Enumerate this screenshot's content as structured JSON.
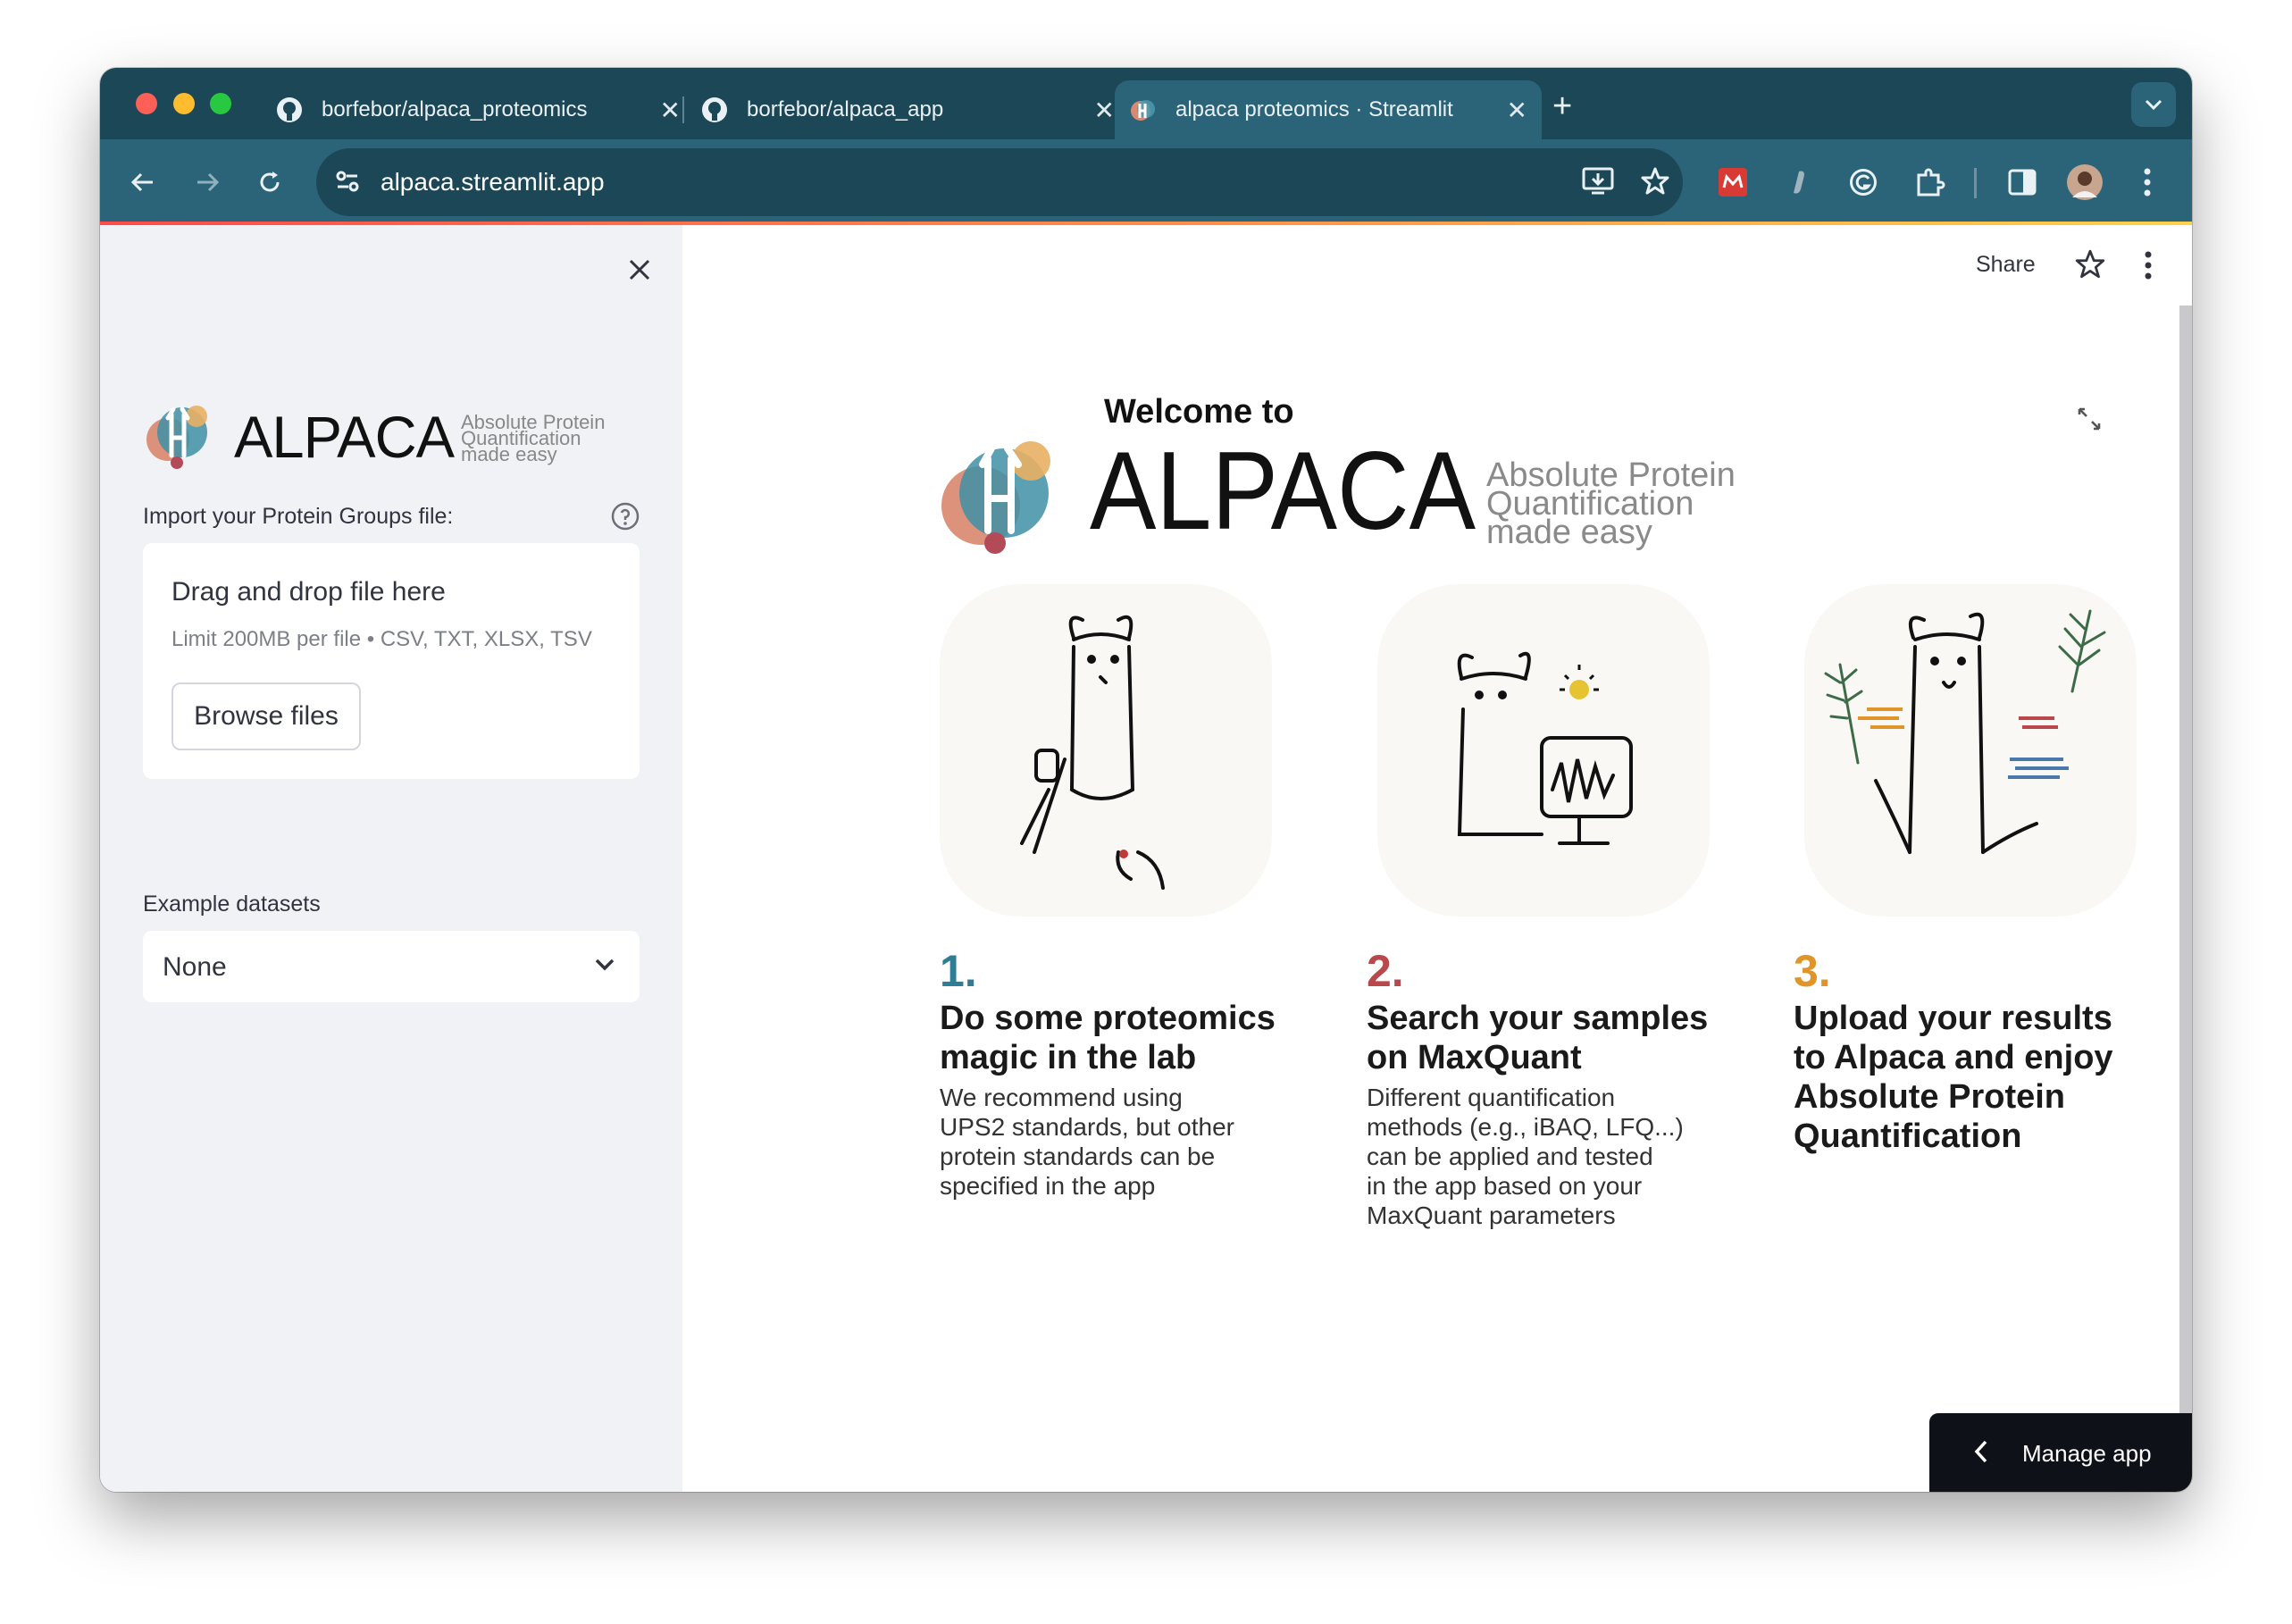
{
  "browser": {
    "tabs": [
      {
        "title": "borfebor/alpaca_proteomics",
        "active": false
      },
      {
        "title": "borfebor/alpaca_app",
        "active": false
      },
      {
        "title": "alpaca proteomics · Streamlit",
        "active": true
      }
    ],
    "url": "alpaca.streamlit.app"
  },
  "sidebar": {
    "logo": {
      "wordmark": "ALPACA",
      "tagline_1": "Absolute Protein",
      "tagline_2": "Quantification",
      "tagline_3": "made easy"
    },
    "upload_label": "Import your Protein Groups file:",
    "uploader": {
      "title": "Drag and drop file here",
      "limit": "Limit 200MB per file • CSV, TXT, XLSX, TSV",
      "browse_label": "Browse files"
    },
    "example_label": "Example datasets",
    "example_value": "None"
  },
  "main": {
    "share_label": "Share",
    "hero": {
      "welcome": "Welcome to",
      "wordmark": "ALPACA",
      "tagline_1": "Absolute Protein",
      "tagline_2": "Quantification",
      "tagline_3": "made easy"
    },
    "steps": [
      {
        "number": "1.",
        "title_1": "Do some proteomics",
        "title_2": "magic in the lab",
        "desc_1": "We recommend using",
        "desc_2": "UPS2 standards, but other",
        "desc_3": "protein standards can be",
        "desc_4": "specified in the app",
        "color": "#2f7d95"
      },
      {
        "number": "2.",
        "title_1": "Search your samples",
        "title_2": "on MaxQuant",
        "desc_1": "Different quantification",
        "desc_2": "methods (e.g., iBAQ, LFQ...)",
        "desc_3": "can be applied and tested",
        "desc_4": "in the app based on your",
        "desc_5": "MaxQuant parameters",
        "color": "#b9484d"
      },
      {
        "number": "3.",
        "title_1": "Upload your results",
        "title_2": "to Alpaca and enjoy",
        "title_3": "Absolute Protein",
        "title_4": "Quantification",
        "color": "#e0952a"
      }
    ]
  },
  "manage_app_label": "Manage app"
}
